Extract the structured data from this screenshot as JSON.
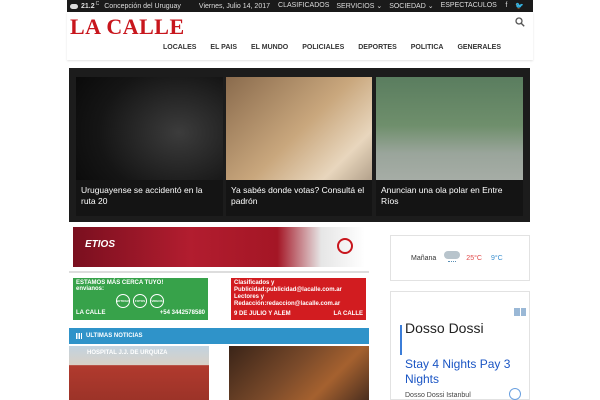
{
  "topbar": {
    "temperature": "21.2",
    "temp_unit": "C",
    "location": "Concepción del Uruguay",
    "date": "Viernes, Julio 14, 2017",
    "menu": [
      "CLASIFICADOS",
      "SERVICIOS ⌄",
      "SOCIEDAD ⌄",
      "ESPECTACULOS"
    ],
    "social_icons": [
      "facebook-icon",
      "twitter-icon"
    ]
  },
  "header": {
    "logo": "LA CALLE",
    "brand_color": "#c8161d",
    "nav": [
      "LOCALES",
      "EL PAIS",
      "EL MUNDO",
      "POLICIALES",
      "DEPORTES",
      "POLITICA",
      "GENERALES"
    ]
  },
  "hero": {
    "cards": [
      {
        "caption": "Uruguayense se accidentó en la ruta 20"
      },
      {
        "caption": "Ya sabés donde votas? Consultá el padrón"
      },
      {
        "caption": "Anuncian una ola polar en Entre Ríos"
      }
    ]
  },
  "ads": {
    "car_brand": "ETIOS",
    "green_headline": "ESTAMOS MÁS CERCA TUYO!",
    "green_sub": "envianos:",
    "green_items": [
      "NOTICIAS",
      "FOTOS",
      "VIDEOS"
    ],
    "green_footer_left": "LA CALLE",
    "green_footer_right": "+54 3442578580",
    "red_line1": "Clasificados y",
    "red_line2": "Publicidad:publicidad@lacalle.com.ar",
    "red_line3": "Lectores y",
    "red_line4": "Redacción:redaccion@lacalle.com.ar",
    "red_footer_left": "9 DE JULIO Y ALEM",
    "red_footer_right": "LA CALLE"
  },
  "ultimas": {
    "title": "ULTIMAS NOTICIAS",
    "img1_label": "HOSPITAL J.J. DE URQUIZA"
  },
  "weather_widget": {
    "label": "Mañana",
    "high": "25°C",
    "low": "9°C"
  },
  "sidebar_ad": {
    "title": "Dosso Dossi",
    "subtitle": "Stay 4 Nights Pay 3 Nights",
    "source": "Dosso Dossi Istanbul"
  },
  "colors": {
    "accent_blue": "#2f93c9",
    "hero_bg": "#1c1c1c",
    "green_ad": "#37a24a",
    "red_ad": "#d21c20"
  }
}
